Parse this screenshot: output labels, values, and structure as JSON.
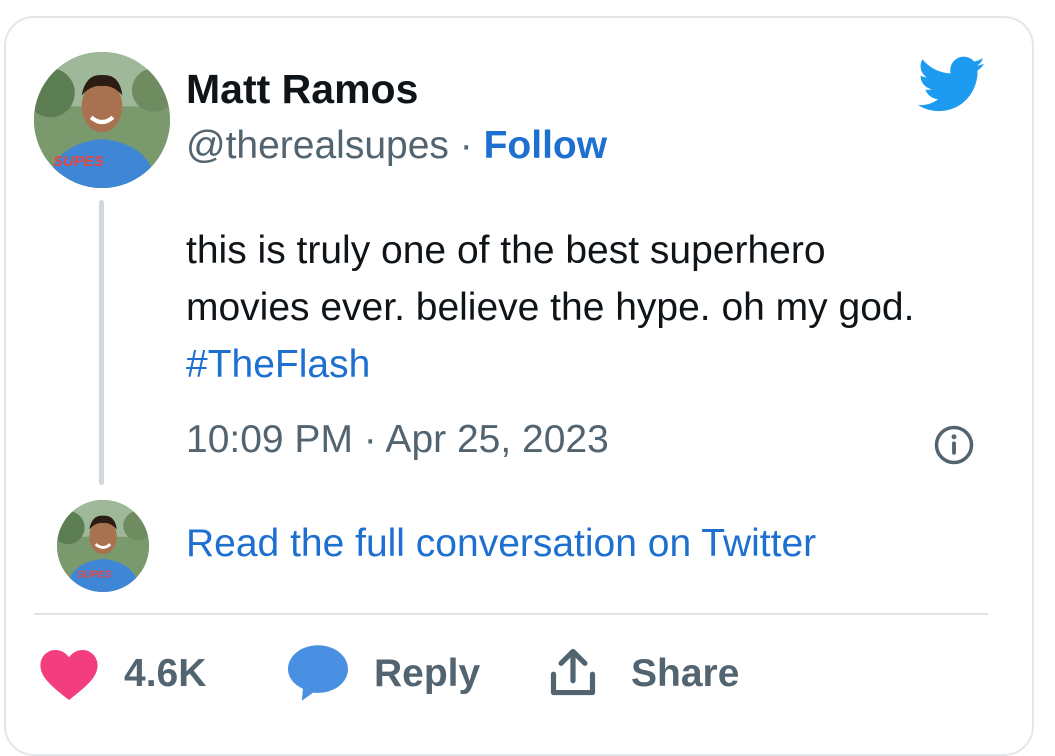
{
  "author": {
    "name": "Matt Ramos",
    "handle": "@therealsupes",
    "separator": "·",
    "follow_label": "Follow",
    "avatar_shirt_text": "SUPES"
  },
  "tweet": {
    "text_before_hashtag": "this is truly one of the best superhero movies ever. believe the hype. oh my god. ",
    "hashtag": "#TheFlash",
    "timestamp": "10:09 PM · Apr 25, 2023"
  },
  "conversation_link": "Read the full conversation on Twitter",
  "actions": {
    "like_count": "4.6K",
    "reply_label": "Reply",
    "share_label": "Share"
  },
  "icons": {
    "brand": "twitter-bird-icon",
    "info": "info-icon",
    "like": "heart-icon",
    "reply": "speech-bubble-icon",
    "share": "upload-icon"
  },
  "colors": {
    "brand_blue": "#1d9bf0",
    "link_blue": "#1d6fd0",
    "like_pink": "#f23d7f",
    "reply_blue": "#4a90e2",
    "text_primary": "#0f1419",
    "text_secondary": "#536471"
  }
}
